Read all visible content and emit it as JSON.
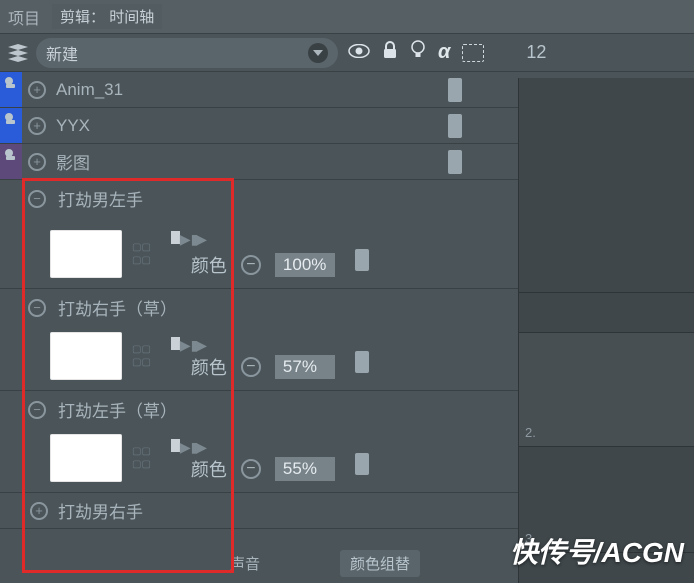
{
  "header": {
    "app": "项目",
    "section": "剪辑：",
    "subsection": "时间轴"
  },
  "toolbar": {
    "new_label": "新建",
    "number": "12"
  },
  "layers": {
    "anim": "Anim_31",
    "yyx": "YYX",
    "shadow": "影图"
  },
  "groups": {
    "g1": {
      "name": "打劫男左手",
      "prop_label": "颜色",
      "percent": "100%"
    },
    "g2": {
      "name": "打劫右手（草）",
      "prop_label": "颜色",
      "percent": "57%"
    },
    "g3": {
      "name": "打劫左手（草）",
      "prop_label": "颜色",
      "percent": "55%"
    },
    "g4": {
      "name": "打劫男右手"
    }
  },
  "right_panel": {
    "r1": "2.",
    "r2": "3."
  },
  "footer": {
    "label1": "声音",
    "box1": "颜色组替"
  },
  "watermark": "快传号/ACGN"
}
